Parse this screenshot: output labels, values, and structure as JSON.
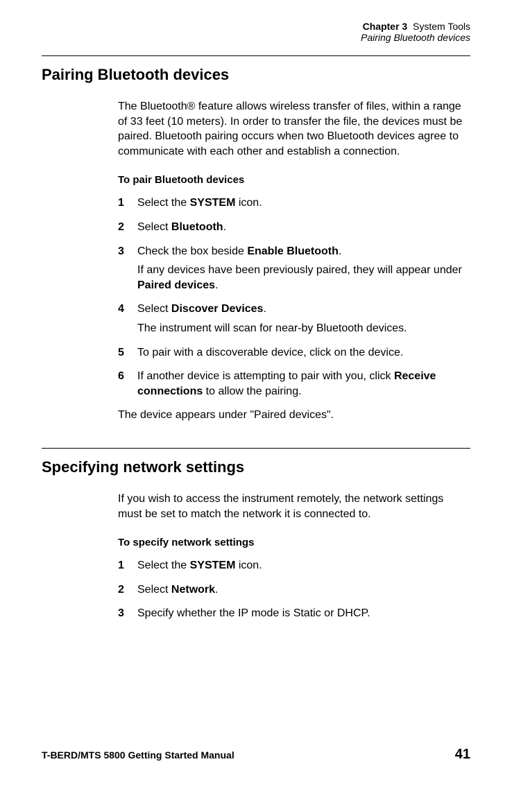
{
  "header": {
    "chapter_label": "Chapter 3",
    "chapter_title": "System Tools",
    "subtitle": "Pairing Bluetooth devices"
  },
  "section1": {
    "heading": "Pairing Bluetooth devices",
    "intro": "The Bluetooth® feature allows wireless transfer of files, within a range of 33 feet (10 meters). In order to transfer the file, the devices must be paired. Bluetooth pairing occurs when two Bluetooth devices agree to communicate with each other and establish a connection.",
    "sub_heading": "To pair Bluetooth devices",
    "steps": [
      {
        "num": "1",
        "prefix": "Select the ",
        "bold1": "SYSTEM",
        "suffix": " icon."
      },
      {
        "num": "2",
        "prefix": "Select ",
        "bold1": "Bluetooth",
        "suffix": "."
      },
      {
        "num": "3",
        "prefix": "Check the box beside ",
        "bold1": "Enable Bluetooth",
        "suffix": ".",
        "sub_prefix": "If any devices have been previously paired, they will appear under ",
        "sub_bold": "Paired devices",
        "sub_suffix": "."
      },
      {
        "num": "4",
        "prefix": "Select ",
        "bold1": "Discover Devices",
        "suffix": ".",
        "sub_plain": "The instrument will scan for near-by Bluetooth devices."
      },
      {
        "num": "5",
        "plain": "To pair with a discoverable device, click on the device."
      },
      {
        "num": "6",
        "prefix": "If another device is attempting to pair with you, click ",
        "bold1": "Receive connections",
        "suffix": " to allow the pairing."
      }
    ],
    "closing": "The device appears under \"Paired devices\"."
  },
  "section2": {
    "heading": "Specifying network settings",
    "intro": "If you wish to access the instrument remotely, the network settings must be set to match the network it is connected to.",
    "sub_heading": "To specify network settings",
    "steps": [
      {
        "num": "1",
        "prefix": "Select the ",
        "bold1": "SYSTEM",
        "suffix": " icon."
      },
      {
        "num": "2",
        "prefix": "Select ",
        "bold1": "Network",
        "suffix": "."
      },
      {
        "num": "3",
        "plain": "Specify whether the IP mode is Static or DHCP."
      }
    ]
  },
  "footer": {
    "text": "T-BERD/MTS 5800 Getting Started Manual",
    "page": "41"
  }
}
